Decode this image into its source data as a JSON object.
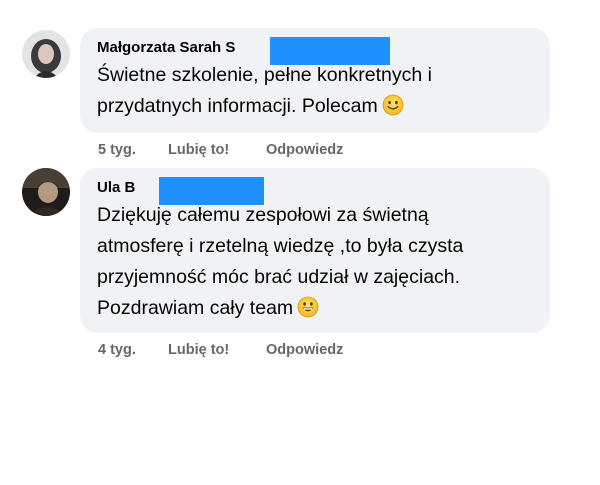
{
  "comments": [
    {
      "author": "Małgorzata Sarah S",
      "text_lines": [
        "Świetne szkolenie, pełne konkretnych i",
        "przydatnych informacji. Polecam"
      ],
      "emoji": "slightly-smiling-face-emoji",
      "time": "5 tyg.",
      "like_label": "Lubię to!",
      "reply_label": "Odpowiedz"
    },
    {
      "author": "Ula B",
      "text_lines": [
        "Dziękuję całemu zespołowi za świetną",
        "atmosferę i rzetelną wiedzę ,to była czysta",
        "przyjemność móc brać udział w zajęciach.",
        "Pozdrawiam cały team"
      ],
      "emoji": "grinning-face-emoji",
      "time": "4 tyg.",
      "like_label": "Lubię to!",
      "reply_label": "Odpowiedz"
    }
  ],
  "colors": {
    "bubble": "#f0f2f5",
    "redaction": "#1e90ff",
    "meta_text": "#65676b",
    "primary_text": "#050505"
  }
}
